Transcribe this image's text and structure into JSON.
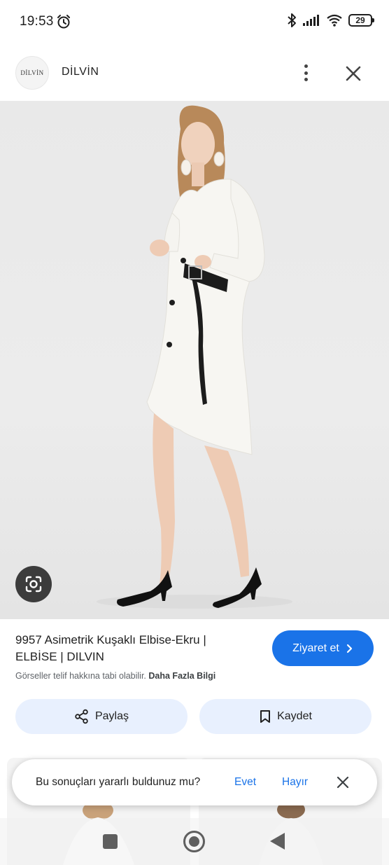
{
  "status_bar": {
    "time": "19:53",
    "battery": "29",
    "icons": [
      "alarm-icon",
      "bluetooth-icon",
      "signal-icon",
      "wifi-icon",
      "battery-icon"
    ]
  },
  "header": {
    "logo_text": "DİLVİN",
    "site_name": "DİLVİN"
  },
  "result": {
    "title": "9957 Asimetrik Kuşaklı Elbise-Ekru | ELBİSE | DILVIN",
    "copyright_text": "Görseller telif hakkına tabi olabilir.",
    "more_info": "Daha Fazla Bilgi",
    "visit_label": "Ziyaret et"
  },
  "actions": {
    "share_label": "Paylaş",
    "save_label": "Kaydet"
  },
  "feedback": {
    "question": "Bu sonuçları yararlı buldunuz mu?",
    "yes": "Evet",
    "no": "Hayır"
  },
  "colors": {
    "accent": "#1a73e8",
    "action_bg": "#e8f0fe"
  }
}
